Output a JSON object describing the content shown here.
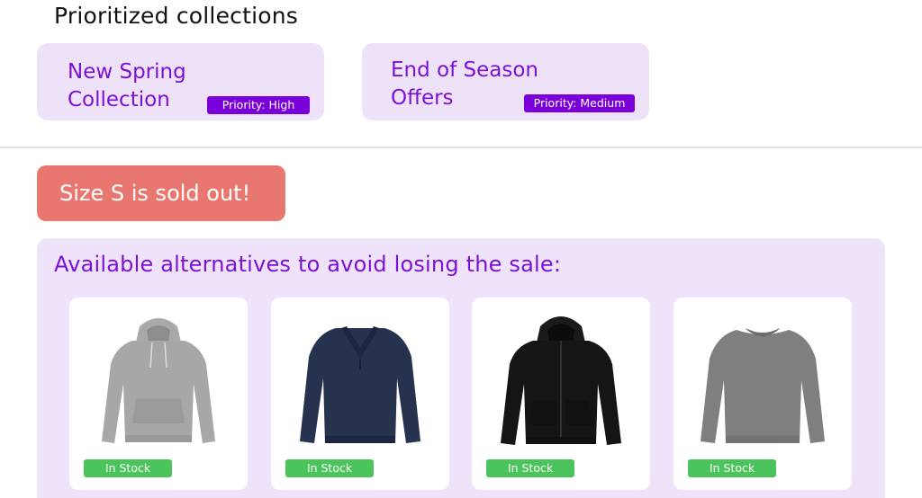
{
  "collections_section": {
    "title": "Prioritized collections",
    "items": [
      {
        "name": "New Spring Collection",
        "priority": "Priority: High"
      },
      {
        "name": "End of Season Offers",
        "priority": "Priority: Medium"
      }
    ]
  },
  "alert": {
    "text": "Size S is sold out!"
  },
  "alternatives": {
    "heading": "Available alternatives to avoid losing the sale:",
    "products": [
      {
        "image": "grey-hoodie",
        "stock": "In Stock"
      },
      {
        "image": "navy-shawl-collar-sweater",
        "stock": "In Stock"
      },
      {
        "image": "black-zip-hoodie",
        "stock": "In Stock"
      },
      {
        "image": "grey-crewneck-sweater",
        "stock": "In Stock"
      }
    ]
  },
  "colors": {
    "accent": "#7b12d6",
    "card_background": "#ede2f8",
    "alert": "#e8776f",
    "in_stock": "#4bc45c"
  }
}
